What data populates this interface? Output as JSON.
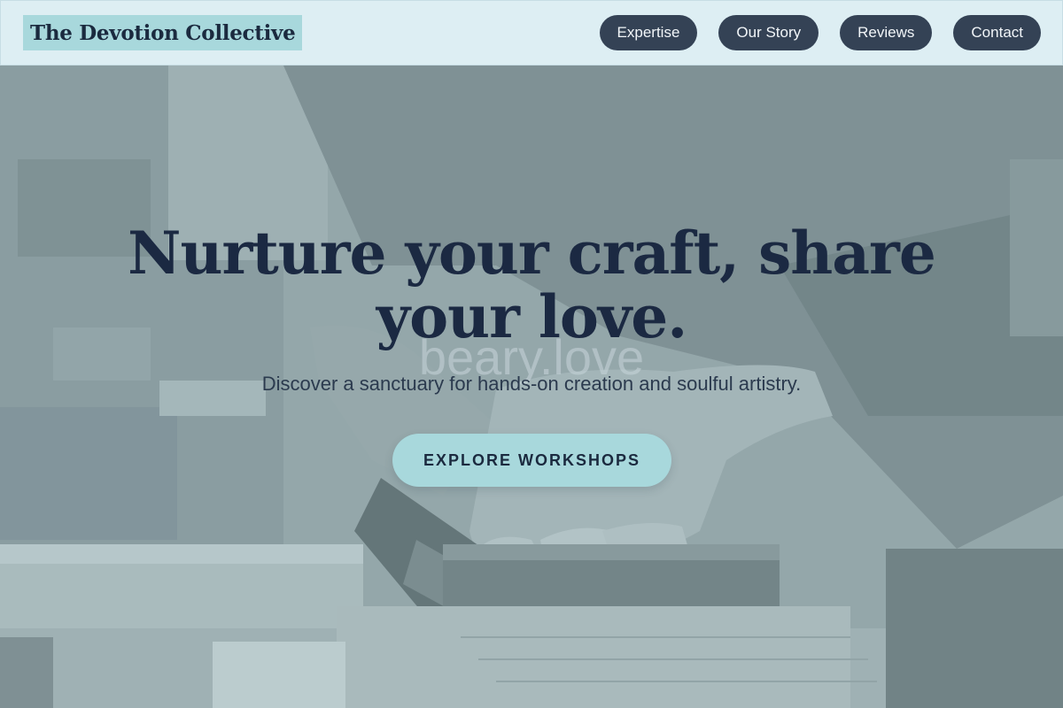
{
  "header": {
    "logo": "The Devotion Collective",
    "nav": [
      {
        "label": "Expertise"
      },
      {
        "label": "Our Story"
      },
      {
        "label": "Reviews"
      },
      {
        "label": "Contact"
      }
    ]
  },
  "hero": {
    "title": "Nurture your craft, share your love.",
    "watermark": "beary.love",
    "subtitle": "Discover a sanctuary for hands-on creation and soulful artistry.",
    "cta_label": "EXPLORE WORKSHOPS",
    "background_image": "hands sawing a wooden block on a workbench"
  },
  "colors": {
    "header_bg": "#dff1f6",
    "logo_bg": "#a8d8dc",
    "nav_button_bg": "#344255",
    "nav_button_text": "#f1f5f8",
    "title_text": "#1b2942",
    "subtitle_text": "#2b3a4e",
    "cta_bg": "#a8d8dc",
    "cta_text": "#1b2a3f"
  }
}
